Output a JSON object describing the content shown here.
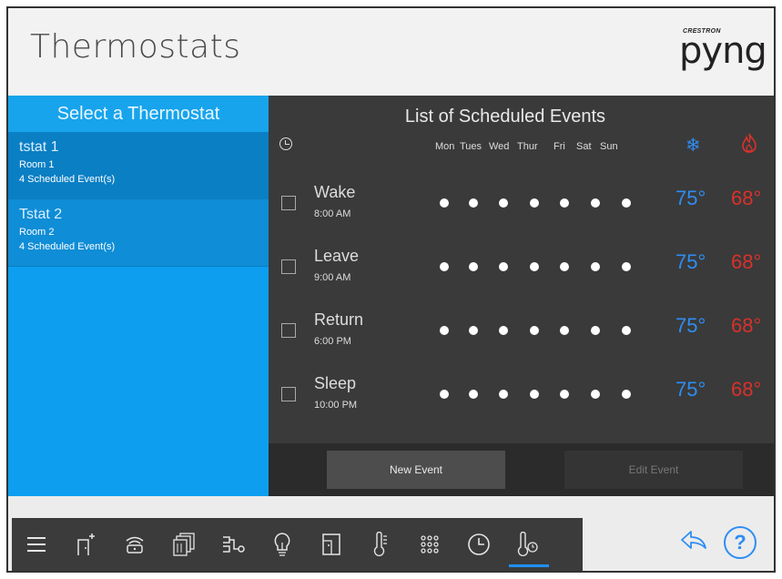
{
  "header": {
    "title": "Thermostats",
    "logo_top": "CRESTRON",
    "logo": "pyng"
  },
  "left_panel": {
    "heading": "Select a Thermostat",
    "thermostats": [
      {
        "name": "tstat 1",
        "room": "Room 1",
        "events": "4 Scheduled Event(s)",
        "selected": true
      },
      {
        "name": "Tstat 2",
        "room": "Room 2",
        "events": "4 Scheduled Event(s)",
        "selected": false
      }
    ]
  },
  "schedule": {
    "title": "List of Scheduled Events",
    "days": [
      "Mon",
      "Tues",
      "Wed",
      "Thur",
      "Fri",
      "Sat",
      "Sun"
    ],
    "cool_icon": "snowflake-icon",
    "heat_icon": "flame-icon",
    "events": [
      {
        "name": "Wake",
        "time": "8:00 AM",
        "cool": "75°",
        "heat": "68°"
      },
      {
        "name": "Leave",
        "time": "9:00 AM",
        "cool": "75°",
        "heat": "68°"
      },
      {
        "name": "Return",
        "time": "6:00 PM",
        "cool": "75°",
        "heat": "68°"
      },
      {
        "name": "Sleep",
        "time": "10:00 PM",
        "cool": "75°",
        "heat": "68°"
      }
    ],
    "new_event_label": "New Event",
    "edit_event_label": "Edit Event"
  },
  "nav": {
    "items": [
      "menu-icon",
      "room-add-icon",
      "media-icon",
      "shades-icon",
      "scenes-icon",
      "lights-icon",
      "door-icon",
      "thermometer-icon",
      "keypad-icon",
      "clock-icon",
      "climate-icon"
    ],
    "active": "climate-icon"
  },
  "colors": {
    "accent": "#0d9ef0",
    "cool": "#2f8df2",
    "heat": "#d9312b",
    "dark_panel": "#3a3a3a"
  }
}
